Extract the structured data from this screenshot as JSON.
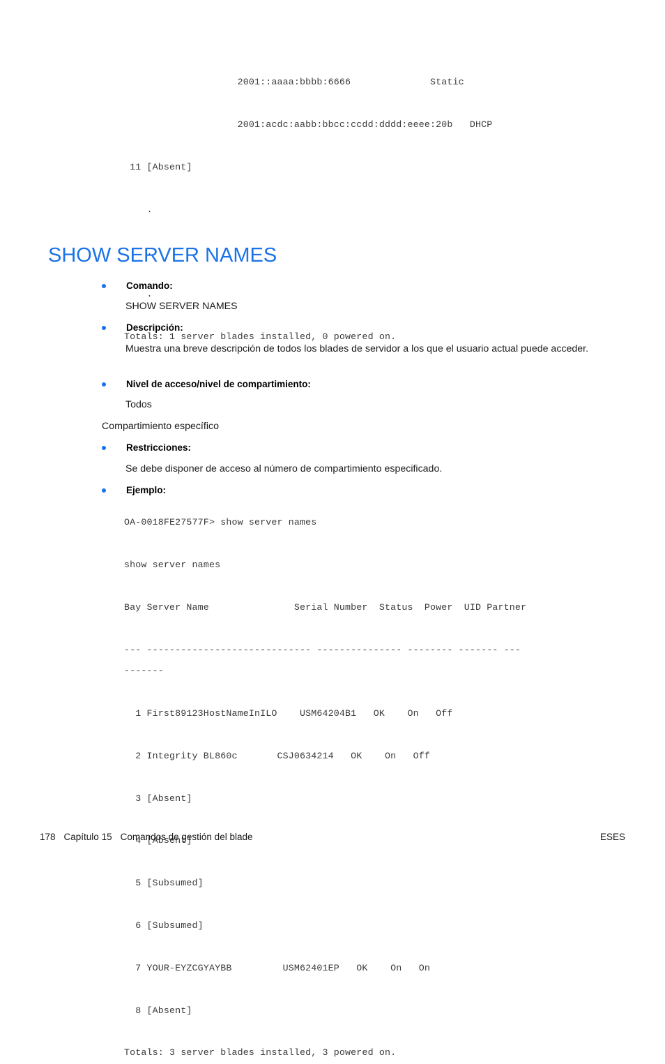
{
  "document": {
    "language": "es",
    "accent_color": "#1a73e8",
    "code_color": "#3a3a3a"
  },
  "top_code_block": "                    2001::aaaa:bbbb:6666              Static\n\n                    2001:acdc:aabb:bbcc:ccdd:dddd:eeee:20b   DHCP\n\n 11 [Absent]\n\n    .\n\n    .\n\n    .\n\nTotals: 1 server blades installed, 0 powered on.",
  "heading": "SHOW SERVER NAMES",
  "sections": [
    {
      "label": "Comando:",
      "body": "SHOW SERVER NAMES"
    },
    {
      "label": "Descripción:",
      "body": "Muestra una breve descripción de todos los blades de servidor a los que el usuario actual puede acceder."
    },
    {
      "label": "Nivel de acceso/nivel de compartimiento:",
      "body": "Todos"
    },
    {
      "label": "Restricciones:",
      "body": "Se debe disponer de acceso al número de compartimiento especificado."
    },
    {
      "label": "Ejemplo:",
      "body": ""
    }
  ],
  "standalone_line": "Compartimiento específico",
  "example_code_block": "OA-0018FE27577F> show server names\n\nshow server names\n\nBay Server Name               Serial Number  Status  Power  UID Partner\n\n--- ----------------------------- --------------- -------- ------- ---\n-------\n\n  1 First89123HostNameInILO    USM64204B1   OK    On   Off\n\n  2 Integrity BL860c       CSJ0634214   OK    On   Off\n\n  3 [Absent]\n\n  4 [Absent]\n\n  5 [Subsumed]\n\n  6 [Subsumed]\n\n  7 YOUR-EYZCGYAYBB         USM62401EP   OK    On   On\n\n  8 [Absent]\n\nTotals: 3 server blades installed, 3 powered on.",
  "footer": {
    "page_number": "178",
    "chapter": "Capítulo 15",
    "chapter_title": "Comandos de gestión del blade",
    "locale_code": "ESES"
  }
}
